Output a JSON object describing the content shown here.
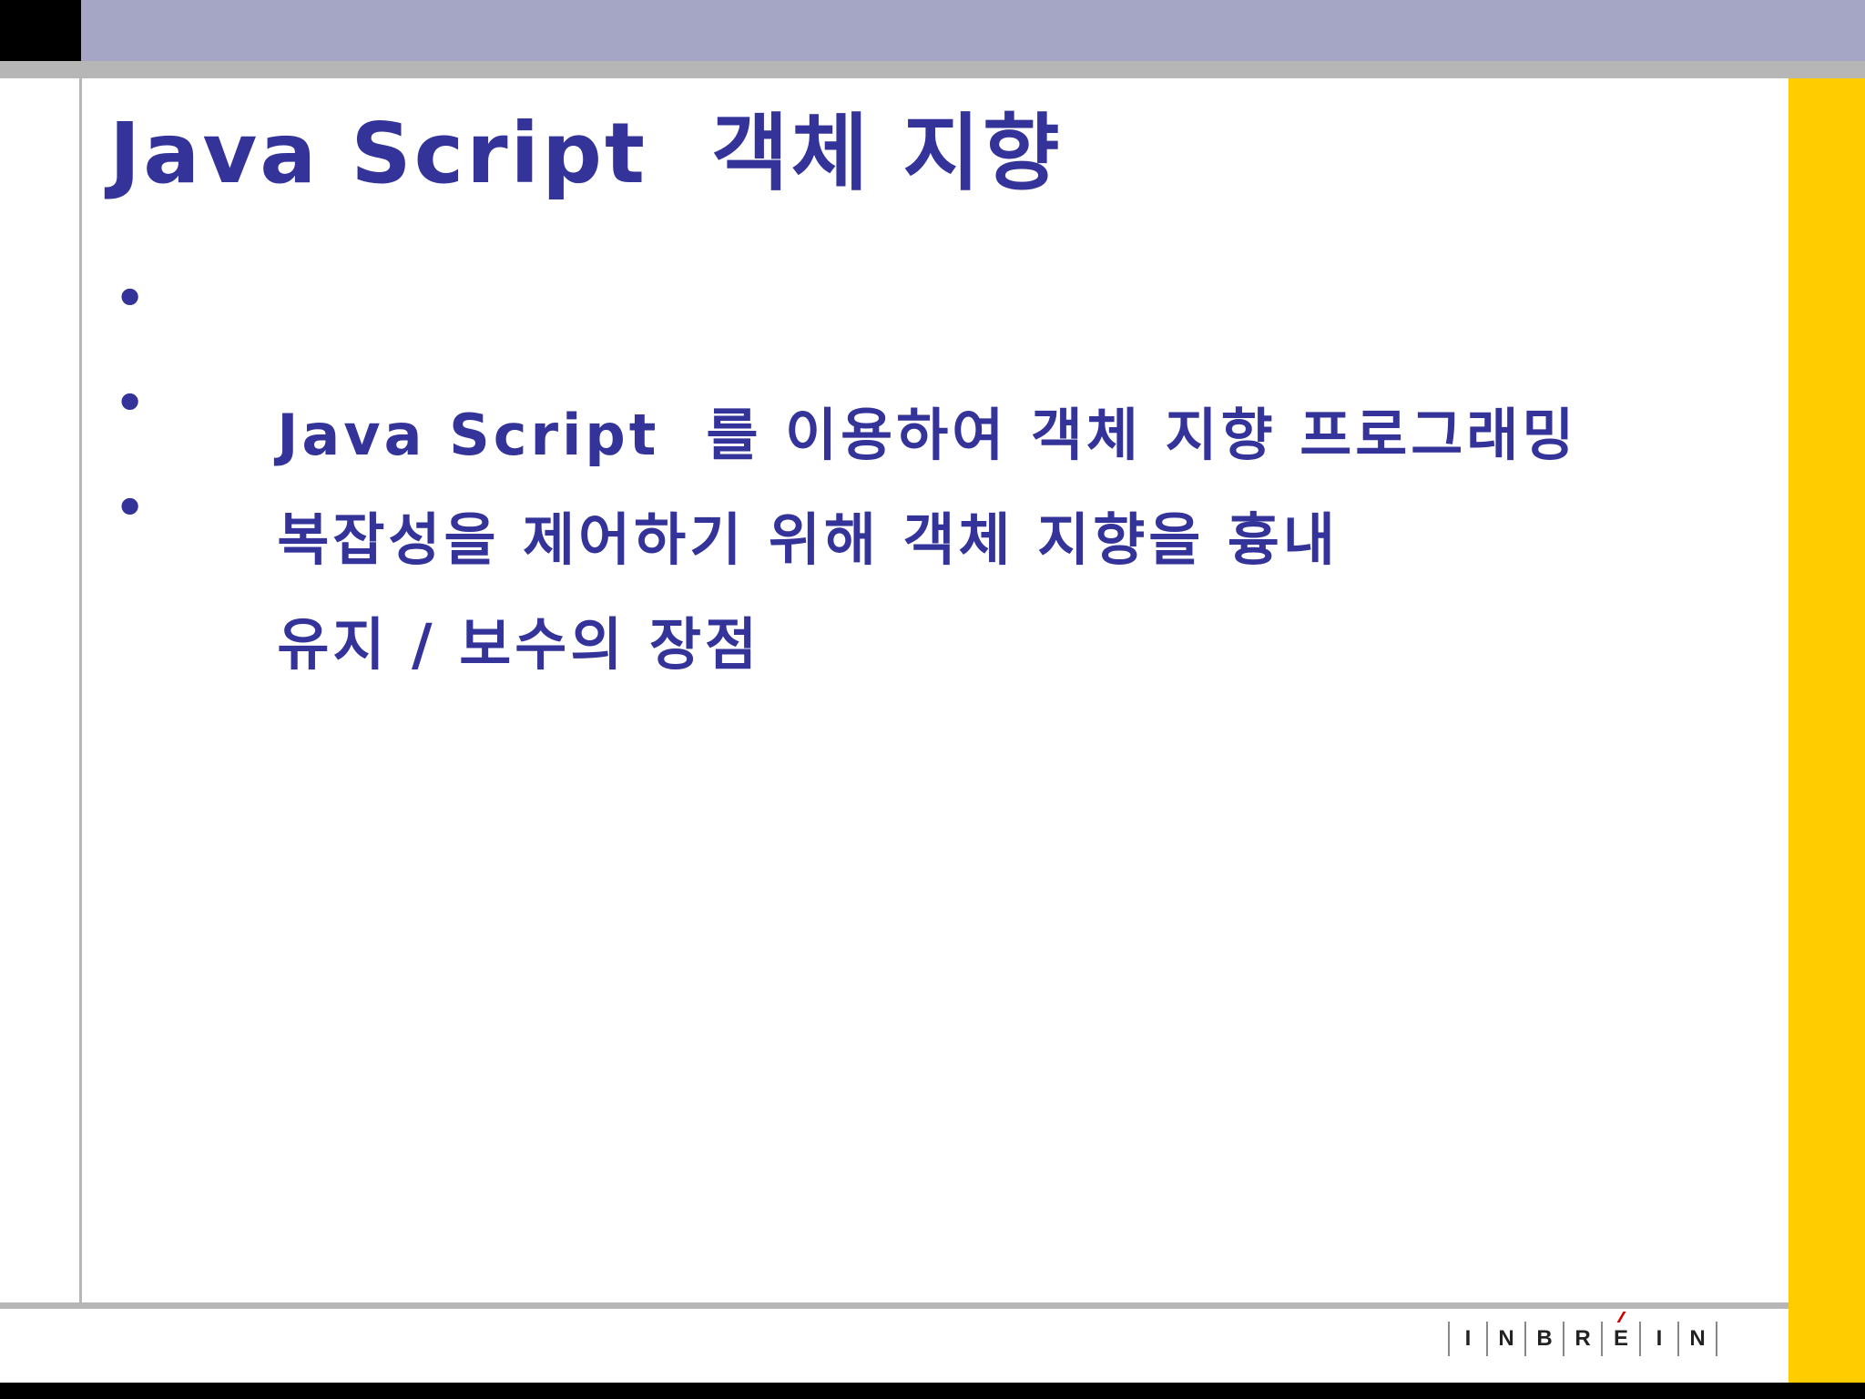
{
  "slide": {
    "title": "Java Script  객체 지향",
    "bullets": [
      "Java Script  를 이용하여 객체 지향 프로그래밍",
      "복잡성을 제어하기 위해 객체 지향을 흉내",
      "유지 / 보수의 장점"
    ],
    "bullet_marker": "•"
  },
  "logo": {
    "letters": [
      "I",
      "N",
      "B",
      "R",
      "E",
      "I",
      "N"
    ]
  },
  "colors": {
    "text": "#333399",
    "top_band": "#a5a6c6",
    "frame_gray": "#b6b6b6",
    "accent_yellow": "#ffcc00",
    "logo_accent": "#cc0000"
  }
}
